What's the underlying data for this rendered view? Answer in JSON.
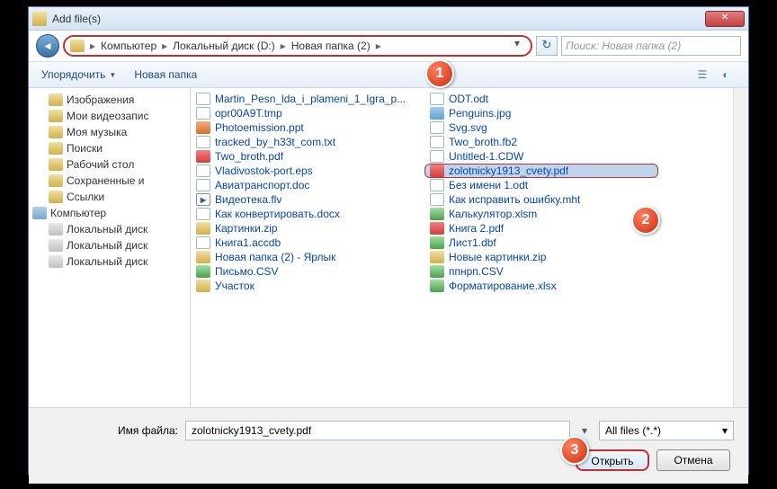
{
  "title": "Add file(s)",
  "breadcrumb": {
    "seg1": "Компьютер",
    "seg2": "Локальный диск (D:)",
    "seg3": "Новая папка (2)"
  },
  "search_placeholder": "Поиск: Новая папка (2)",
  "toolbar": {
    "organize": "Упорядочить",
    "newfolder": "Новая папка"
  },
  "sidebar": {
    "items": [
      {
        "label": "Изображения",
        "cls": "folder-ico",
        "ind": 1
      },
      {
        "label": "Мои видеозапис",
        "cls": "folder-ico",
        "ind": 1
      },
      {
        "label": "Моя музыка",
        "cls": "folder-ico",
        "ind": 1
      },
      {
        "label": "Поиски",
        "cls": "folder-ico",
        "ind": 1
      },
      {
        "label": "Рабочий стол",
        "cls": "folder-ico",
        "ind": 1
      },
      {
        "label": "Сохраненные и",
        "cls": "folder-ico",
        "ind": 1
      },
      {
        "label": "Ссылки",
        "cls": "folder-ico",
        "ind": 1
      },
      {
        "label": "Компьютер",
        "cls": "comp-ico",
        "ind": 0
      },
      {
        "label": "Локальный диск",
        "cls": "drive-ico",
        "ind": 1
      },
      {
        "label": "Локальный диск",
        "cls": "drive-ico",
        "ind": 1
      },
      {
        "label": "Локальный диск",
        "cls": "drive-ico",
        "ind": 1
      }
    ]
  },
  "col1": [
    {
      "name": "Martin_Pesn_lda_i_plameni_1_Igra_p...",
      "ico": "i-doc",
      "link": true
    },
    {
      "name": "opr00A9T.tmp",
      "ico": "i-doc",
      "link": true
    },
    {
      "name": "Photoemission.ppt",
      "ico": "i-ppt",
      "link": true
    },
    {
      "name": "tracked_by_h33t_com.txt",
      "ico": "i-doc",
      "link": true
    },
    {
      "name": "Two_broth.pdf",
      "ico": "i-pdf",
      "link": true
    },
    {
      "name": "Vladivostok-port.eps",
      "ico": "i-doc",
      "link": true
    },
    {
      "name": "Авиатранспорт.doc",
      "ico": "i-doc",
      "link": true
    },
    {
      "name": "Видеотека.flv",
      "ico": "i-vid",
      "link": true
    },
    {
      "name": "Как конвертировать.docx",
      "ico": "i-doc",
      "link": true
    },
    {
      "name": "Картинки.zip",
      "ico": "i-zip",
      "link": true
    },
    {
      "name": "Книга1.accdb",
      "ico": "i-doc",
      "link": true
    },
    {
      "name": "Новая папка (2) - Ярлык",
      "ico": "i-fld",
      "link": true
    },
    {
      "name": "Письмо.CSV",
      "ico": "i-xls",
      "link": true
    },
    {
      "name": "Участок",
      "ico": "i-fld",
      "link": true
    }
  ],
  "col2": [
    {
      "name": "ODT.odt",
      "ico": "i-doc",
      "link": true
    },
    {
      "name": "Penguins.jpg",
      "ico": "i-img",
      "link": true
    },
    {
      "name": "Svg.svg",
      "ico": "i-doc",
      "link": true
    },
    {
      "name": "Two_broth.fb2",
      "ico": "i-doc",
      "link": true
    },
    {
      "name": "Untitled-1.CDW",
      "ico": "i-doc",
      "link": true
    },
    {
      "name": "zolotnicky1913_cvety.pdf",
      "ico": "i-pdf",
      "link": true,
      "selected": true
    },
    {
      "name": "Без имени 1.odt",
      "ico": "i-doc",
      "link": true
    },
    {
      "name": "Как исправить ошибку.mht",
      "ico": "i-doc",
      "link": true
    },
    {
      "name": "Калькулятор.xlsm",
      "ico": "i-xls",
      "link": true
    },
    {
      "name": "Книга 2.pdf",
      "ico": "i-pdf",
      "link": true
    },
    {
      "name": "Лист1.dbf",
      "ico": "i-xls",
      "link": true
    },
    {
      "name": "Новые картинки.zip",
      "ico": "i-zip",
      "link": true
    },
    {
      "name": "ппнрп.CSV",
      "ico": "i-xls",
      "link": true
    },
    {
      "name": "Форматирование.xlsx",
      "ico": "i-xls",
      "link": true
    }
  ],
  "filename_label": "Имя файла:",
  "filename_value": "zolotnicky1913_cvety.pdf",
  "filter": "All files (*.*)",
  "open_btn": "Открыть",
  "cancel_btn": "Отмена",
  "callouts": {
    "c1": "1",
    "c2": "2",
    "c3": "3"
  }
}
